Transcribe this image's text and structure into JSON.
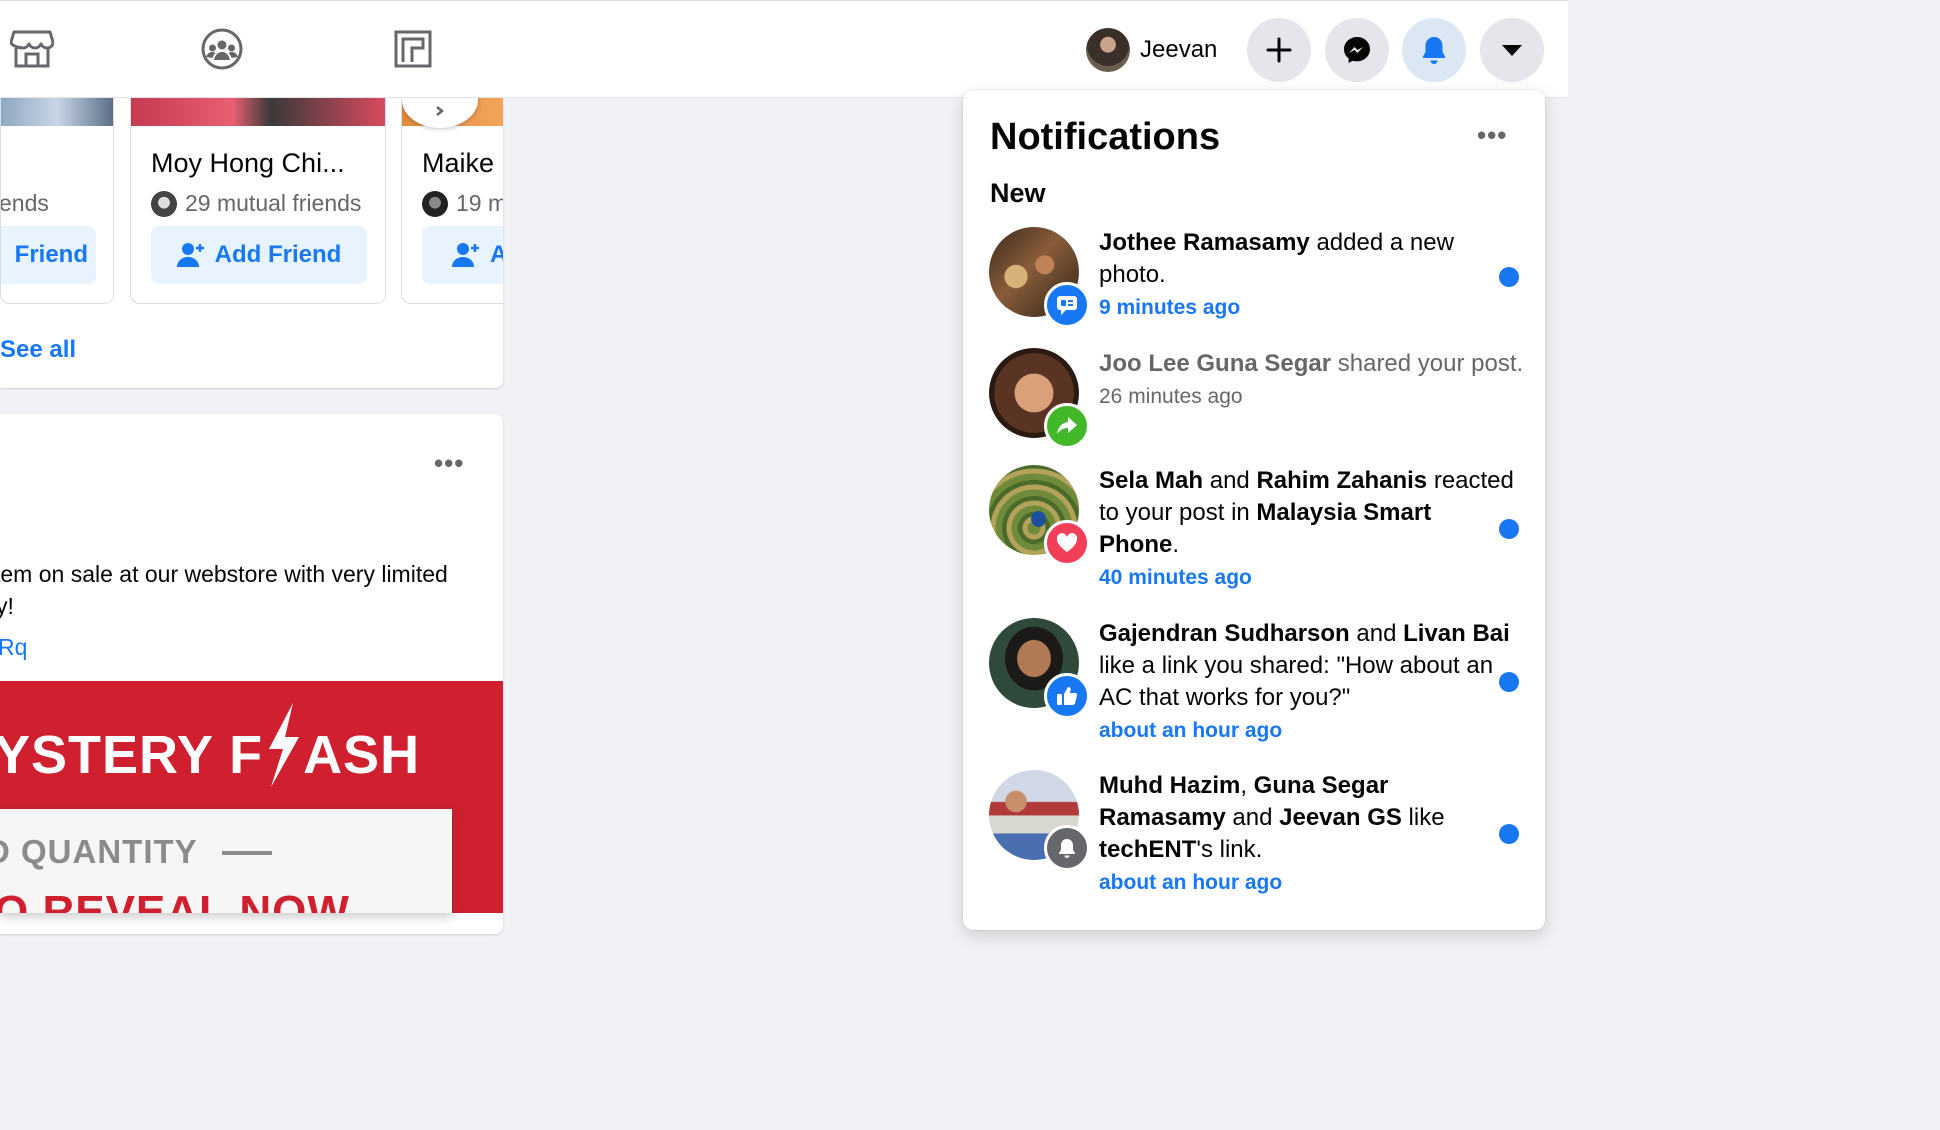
{
  "header": {
    "user_name": "Jeevan",
    "nav_icons": [
      "marketplace-icon",
      "groups-icon",
      "gaming-icon"
    ],
    "action_buttons": [
      "create-icon",
      "messenger-icon",
      "notifications-icon",
      "account-menu-icon"
    ]
  },
  "people_you_may_know": {
    "cards": [
      {
        "name": "",
        "mutual": "ends",
        "button": "Friend"
      },
      {
        "name": "Moy Hong Chi...",
        "mutual": "29 mutual friends",
        "button": "Add Friend"
      },
      {
        "name": "Maike",
        "mutual": "19 m",
        "button": "A"
      }
    ],
    "see_all": "See all"
  },
  "post": {
    "more": "•••",
    "text": "tem on sale at our webstore with very limited y!",
    "text_line1": "tem on sale at our webstore with very limited",
    "text_line2": "y!",
    "link": "Rq",
    "banner_left": "YSTERY F",
    "banner_right": "ASH",
    "quantity": "D QUANTITY",
    "reveal": "O REVEAL NOW"
  },
  "notifications": {
    "title": "Notifications",
    "more": "•••",
    "section": "New",
    "items": [
      {
        "parts": [
          {
            "b": "Jothee Ramasamy"
          },
          {
            "t": " added a new photo."
          }
        ],
        "time": "9 minutes ago",
        "unread": true,
        "badge": "photo-comment-icon",
        "badge_color": "#1877f2"
      },
      {
        "parts": [
          {
            "b": "Joo Lee Guna Segar"
          },
          {
            "t": " shared your post."
          }
        ],
        "time": "26 minutes ago",
        "unread": false,
        "badge": "share-icon",
        "badge_color": "#42b72a"
      },
      {
        "parts": [
          {
            "b": "Sela Mah"
          },
          {
            "t": " and "
          },
          {
            "b": "Rahim Zahanis"
          },
          {
            "t": " reacted to your post in "
          },
          {
            "b": "Malaysia Smart Phone"
          },
          {
            "t": "."
          }
        ],
        "time": "40 minutes ago",
        "unread": true,
        "badge": "love-reaction-icon",
        "badge_color": "#f33e58"
      },
      {
        "parts": [
          {
            "b": "Gajendran Sudharson"
          },
          {
            "t": " and "
          },
          {
            "b": "Livan Bai"
          },
          {
            "t": " like a link you shared: \"How about an AC that works for you?\""
          }
        ],
        "time": "about an hour ago",
        "unread": true,
        "badge": "like-icon",
        "badge_color": "#1877f2"
      },
      {
        "parts": [
          {
            "b": "Muhd Hazim"
          },
          {
            "t": ", "
          },
          {
            "b": "Guna Segar Ramasamy"
          },
          {
            "t": " and "
          },
          {
            "b": "Jeevan GS"
          },
          {
            "t": " like "
          },
          {
            "b": "techENT"
          },
          {
            "t": "'s link."
          }
        ],
        "time": "about an hour ago",
        "unread": true,
        "badge": "bell-icon",
        "badge_color": "#65676b"
      }
    ]
  },
  "colors": {
    "accent": "#1877f2",
    "background": "#f0f2f5",
    "banner_red": "#d0202f"
  }
}
